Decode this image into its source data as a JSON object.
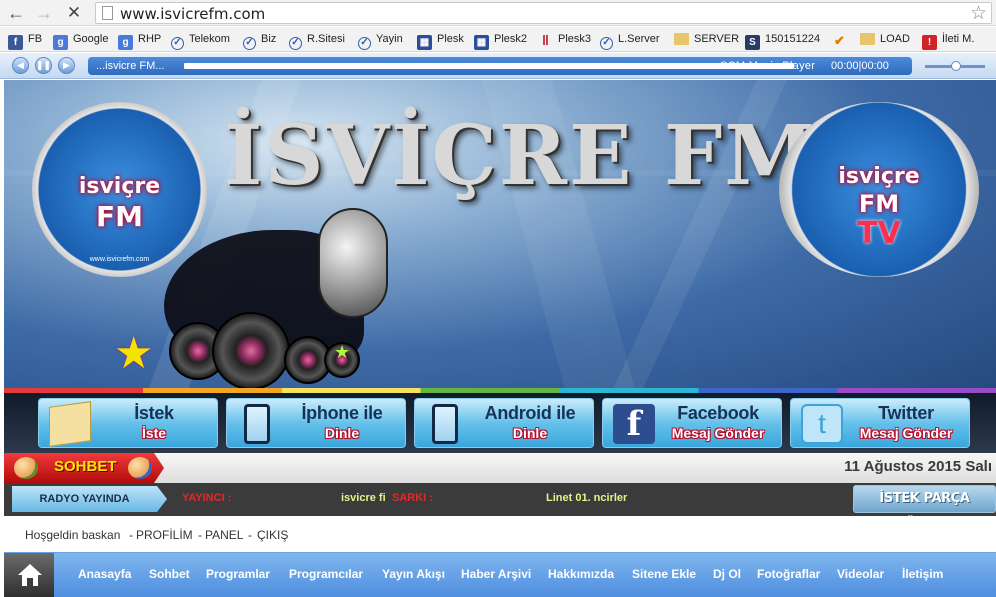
{
  "browser": {
    "url": "www.isvicrefm.com",
    "bookmarks": [
      {
        "label": "FB",
        "icon": "facebook-icon"
      },
      {
        "label": "Google",
        "icon": "google-icon"
      },
      {
        "label": "RHP",
        "icon": "google-icon"
      },
      {
        "label": "Telekom",
        "icon": "check-circle-icon"
      },
      {
        "label": "Biz",
        "icon": "check-circle-icon"
      },
      {
        "label": "R.Sitesi",
        "icon": "check-circle-icon"
      },
      {
        "label": "Yayin",
        "icon": "check-circle-icon"
      },
      {
        "label": "Plesk",
        "icon": "plesk-icon"
      },
      {
        "label": "Plesk2",
        "icon": "plesk-icon"
      },
      {
        "label": "Plesk3",
        "icon": "plesk3-icon"
      },
      {
        "label": "L.Server",
        "icon": "check-circle-icon"
      },
      {
        "label": "SERVER",
        "icon": "folder-icon"
      },
      {
        "label": "150151224",
        "icon": "server-icon"
      },
      {
        "label": "",
        "icon": "checkmark-icon"
      },
      {
        "label": "LOAD",
        "icon": "folder-icon"
      },
      {
        "label": "İleti M.",
        "icon": "message-icon"
      }
    ]
  },
  "player": {
    "title": "...isvicre FM...",
    "name": "SCM Music Player",
    "time": "00:00|00:00"
  },
  "banner": {
    "title": "İSVİÇRE FM",
    "left_logo_text": "isviçre",
    "left_logo_sub": "FM",
    "right_logo_text": "isviçre",
    "right_logo_sub": "FM",
    "right_logo_tv": "TV",
    "logo_url": "www.isvicrefm.com"
  },
  "actions": [
    {
      "line1": "İstek",
      "line2": "İste",
      "icon": "envelope-icon"
    },
    {
      "line1": "İphone ile",
      "line2": "Dinle",
      "icon": "iphone-icon"
    },
    {
      "line1": "Android ile",
      "line2": "Dinle",
      "icon": "android-phone-icon"
    },
    {
      "line1": "Facebook",
      "line2": "Mesaj Gönder",
      "icon": "facebook-icon"
    },
    {
      "line1": "Twitter",
      "line2": "Mesaj Gönder",
      "icon": "twitter-icon"
    }
  ],
  "chat": {
    "label": "SOHBET",
    "date": "11 Ağustos 2015 Salı"
  },
  "radio": {
    "live_label": "RADYO YAYINDA",
    "dj_label": "YAYINCI :",
    "dj_value": "isvicre fi",
    "song_label": "SARKI :",
    "song_value": "Linet 01. ncirler",
    "request_button": "İSTEK PARÇA GÖNDER"
  },
  "welcome": {
    "greeting": "Hoşgeldin baskan",
    "sep": "-",
    "profile": "PROFİLİM",
    "panel": "PANEL",
    "logout": "ÇIKIŞ"
  },
  "nav": [
    "Anasayfa",
    "Sohbet",
    "Programlar",
    "Programcılar",
    "Yayın Akışı",
    "Haber Arşivi",
    "Hakkımızda",
    "Sitene Ekle",
    "Dj Ol",
    "Fotoğraflar",
    "Videolar",
    "İletişim"
  ]
}
